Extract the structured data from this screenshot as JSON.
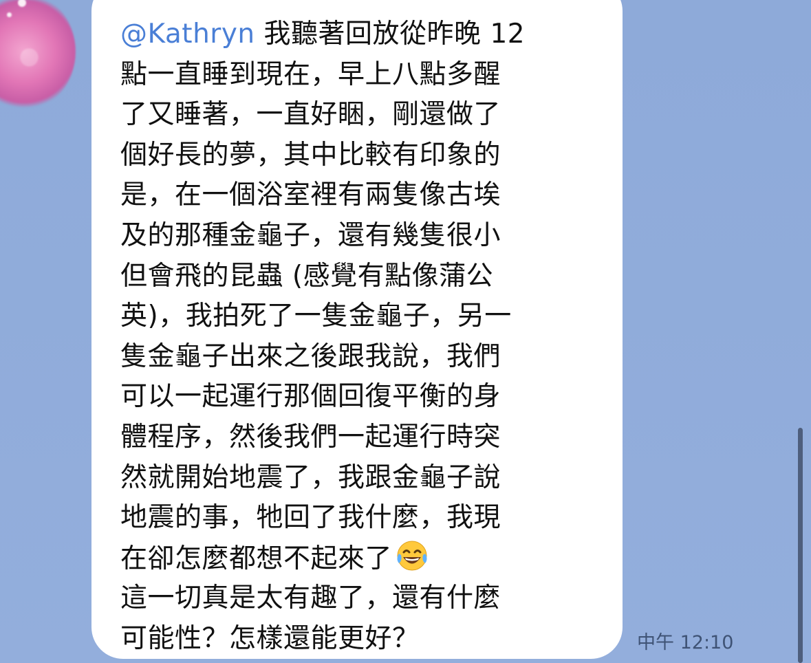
{
  "chat": {
    "message": {
      "mention": "@Kathryn",
      "lines": [
        "我聽著回放從昨晚 12",
        "點一直睡到現在，早上八點多醒",
        "了又睡著，一直好睏，剛還做了",
        "個好長的夢，其中比較有印象的",
        "是，在一個浴室裡有兩隻像古埃",
        "及的那種金龜子，還有幾隻很小",
        "但會飛的昆蟲 (感覺有點像蒲公",
        "英)，我拍死了一隻金龜子，另一",
        "隻金龜子出來之後跟我說，我們",
        "可以一起運行那個回復平衡的身",
        "體程序，然後我們一起運行時突",
        "然就開始地震了，我跟金龜子說",
        "地震的事，牠回了我什麼，我現",
        "在卻怎麼都想不起來了",
        "這一切真是太有趣了，還有什麼",
        "可能性？怎樣還能更好？"
      ],
      "emoji": "face-with-tears-of-joy-icon",
      "timestamp": "中午 12:10"
    }
  },
  "colors": {
    "background": "#8fabd8",
    "bubble": "#ffffff",
    "mention": "#4a7fd6",
    "text": "#111111",
    "timestamp": "#3f5375"
  }
}
